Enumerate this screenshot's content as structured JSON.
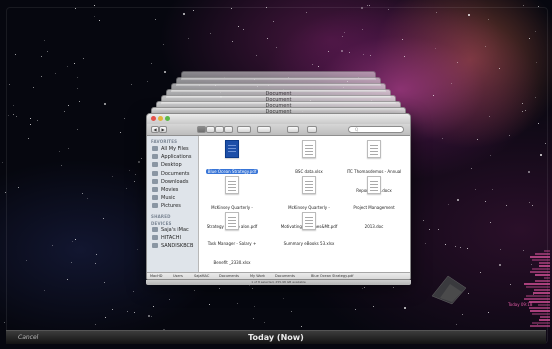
{
  "stack_windows": [
    {
      "title": ""
    },
    {
      "title": ""
    },
    {
      "title": ""
    },
    {
      "title": "Document"
    },
    {
      "title": "Document"
    },
    {
      "title": "Document"
    },
    {
      "title": "Document"
    }
  ],
  "finder": {
    "toolbar": {
      "back_label": "◀",
      "forward_label": "▶",
      "search_placeholder": "Q"
    },
    "sidebar": {
      "favorites_header": "FAVORITES",
      "favorites": [
        "All My Files",
        "Applications",
        "Desktop",
        "Documents",
        "Downloads",
        "Movies",
        "Music",
        "Pictures"
      ],
      "shared_header": "SHARED",
      "devices_header": "DEVICES",
      "devices": [
        "Saja's iMac",
        "HITACHI",
        "SANDISKBCB"
      ]
    },
    "files": [
      {
        "name": "Blue Ocean Strategy.pdf",
        "selected": true,
        "icon": "pdf-blue-icon"
      },
      {
        "name": "BSC data.xlsx",
        "selected": false,
        "icon": "spreadsheet-icon"
      },
      {
        "name": "ITC Thomasdemos - Annual Report 2012.docx",
        "selected": false,
        "icon": "document-icon"
      },
      {
        "name": "McKinsey Quarterly - Strategy & ....go alon.pdf",
        "selected": false,
        "icon": "pdf-icon"
      },
      {
        "name": "McKinsey Quarterly - MotivatingFrontlines&Mt.pdf",
        "selected": false,
        "icon": "pdf-icon"
      },
      {
        "name": "Project Management 2013.doc",
        "selected": false,
        "icon": "document-icon"
      },
      {
        "name": "Task Manager - Salary + Benefit _2330.xlsx",
        "selected": false,
        "icon": "spreadsheet-icon"
      },
      {
        "name": "Summary eBooks 53.xlsx",
        "selected": false,
        "icon": "document-icon"
      }
    ],
    "pathbar": [
      "MacHD",
      "Users",
      "SajaMAC",
      "Documents",
      "My Work",
      "Documents",
      "Blue Ocean Strategy.pdf"
    ],
    "status_text": "1 of 8 selected, 255.98 GB available"
  },
  "bottom_bar": {
    "cancel_label": "Cancel",
    "date_label": "Today (Now)"
  },
  "timeline": {
    "today_label": "Today 09:18"
  },
  "colors": {
    "selection": "#3875d7",
    "timeline": "#c34a8d"
  }
}
